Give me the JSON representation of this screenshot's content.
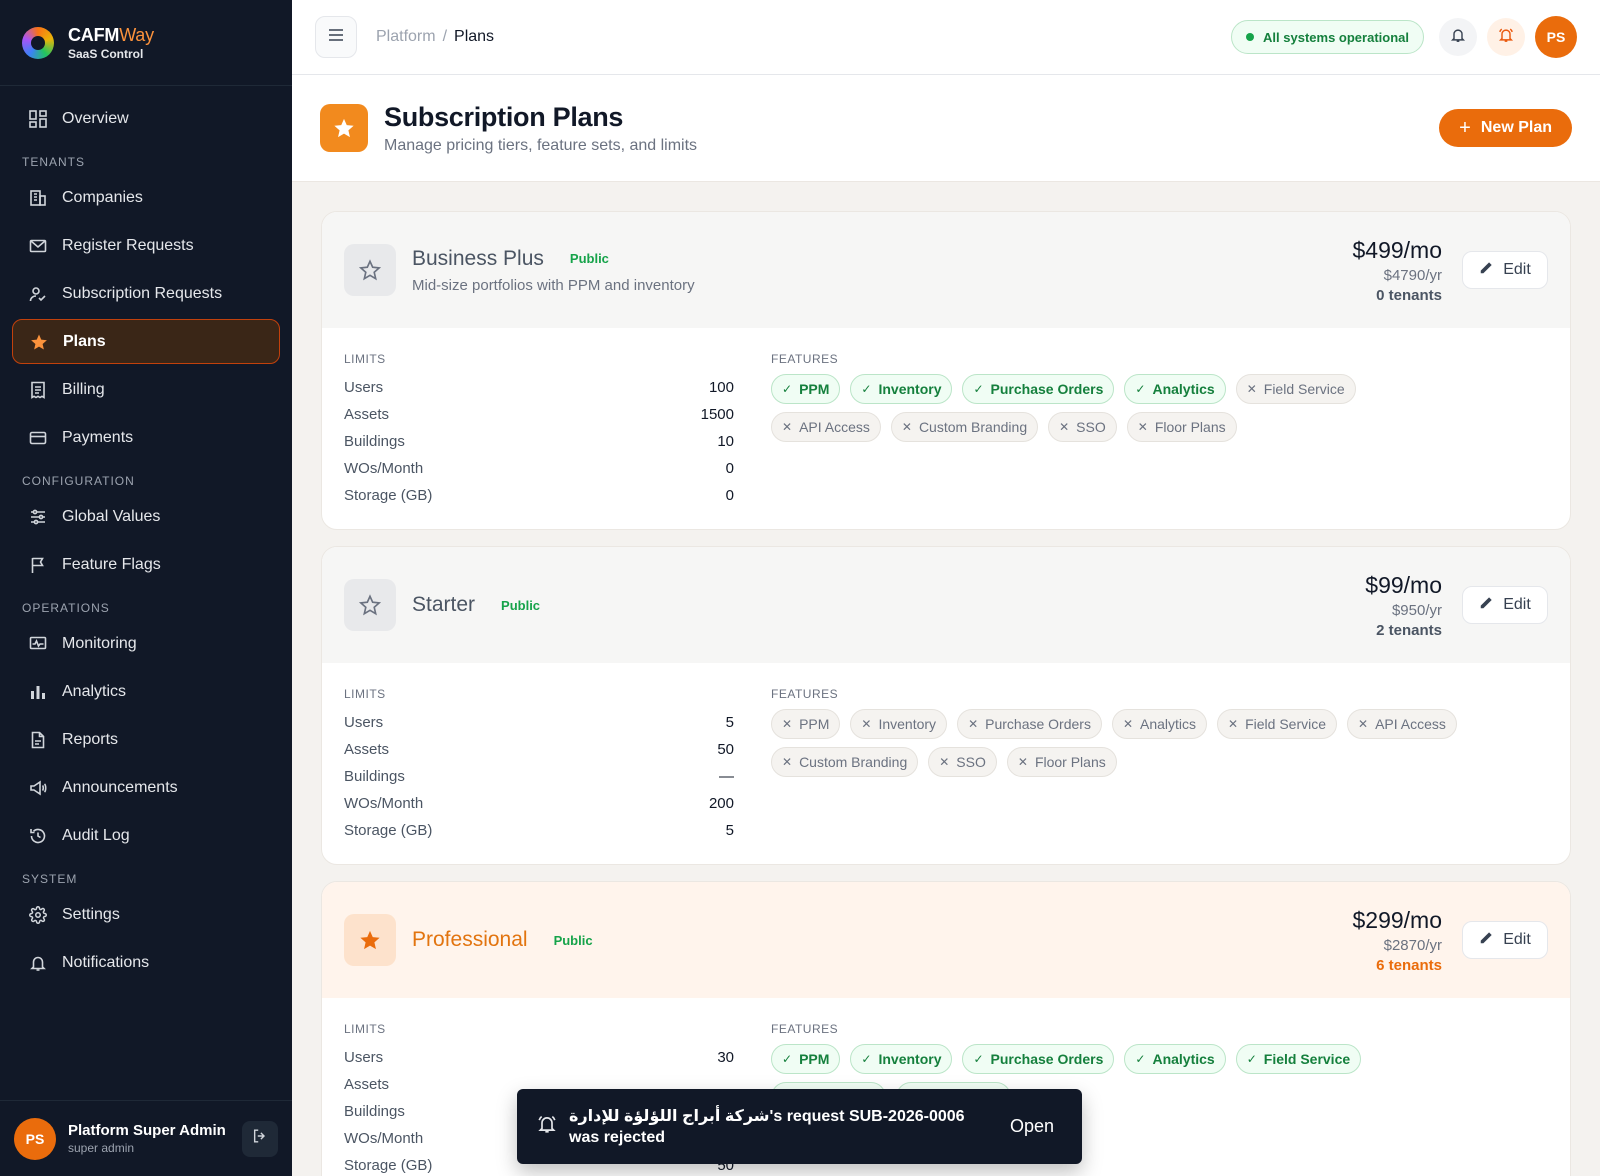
{
  "brand": {
    "name_main": "CAFM",
    "name_accent": "Way",
    "subtitle": "SaaS Control"
  },
  "sidebar": {
    "sections": {
      "tenants": "TENANTS",
      "configuration": "CONFIGURATION",
      "operations": "OPERATIONS",
      "system": "SYSTEM"
    },
    "items": {
      "overview": "Overview",
      "companies": "Companies",
      "register_requests": "Register Requests",
      "subscription_requests": "Subscription Requests",
      "plans": "Plans",
      "billing": "Billing",
      "payments": "Payments",
      "global_values": "Global Values",
      "feature_flags": "Feature Flags",
      "monitoring": "Monitoring",
      "analytics": "Analytics",
      "reports": "Reports",
      "announcements": "Announcements",
      "audit_log": "Audit Log",
      "settings": "Settings",
      "notifications": "Notifications"
    },
    "user": {
      "initials": "PS",
      "name": "Platform Super Admin",
      "role": "super admin"
    }
  },
  "topbar": {
    "breadcrumb": [
      "Platform",
      "Plans"
    ],
    "breadcrumb_sep": "/",
    "status": "All systems operational",
    "avatar_initials": "PS"
  },
  "page": {
    "title": "Subscription Plans",
    "subtitle": "Manage pricing tiers, feature sets, and limits",
    "new_button": "New Plan"
  },
  "labels": {
    "limits": "LIMITS",
    "features": "FEATURES",
    "edit": "Edit"
  },
  "colors": {
    "accent": "#ea6c0c",
    "sidebar_bg": "#111827",
    "success": "#16a34a"
  },
  "plans": [
    {
      "name": "Business Plus",
      "visibility": "Public",
      "description": "Mid-size portfolios with PPM and inventory",
      "price_month": "$499/mo",
      "price_year": "$4790/yr",
      "tenants": "0 tenants",
      "featured": false,
      "limits": [
        {
          "label": "Users",
          "value": "100"
        },
        {
          "label": "Assets",
          "value": "1500"
        },
        {
          "label": "Buildings",
          "value": "10"
        },
        {
          "label": "WOs/Month",
          "value": "0"
        },
        {
          "label": "Storage (GB)",
          "value": "0"
        }
      ],
      "features": [
        {
          "label": "PPM",
          "enabled": true
        },
        {
          "label": "Inventory",
          "enabled": true
        },
        {
          "label": "Purchase Orders",
          "enabled": true
        },
        {
          "label": "Analytics",
          "enabled": true
        },
        {
          "label": "Field Service",
          "enabled": false
        },
        {
          "label": "API Access",
          "enabled": false
        },
        {
          "label": "Custom Branding",
          "enabled": false
        },
        {
          "label": "SSO",
          "enabled": false
        },
        {
          "label": "Floor Plans",
          "enabled": false
        }
      ]
    },
    {
      "name": "Starter",
      "visibility": "Public",
      "description": "",
      "price_month": "$99/mo",
      "price_year": "$950/yr",
      "tenants": "2 tenants",
      "featured": false,
      "limits": [
        {
          "label": "Users",
          "value": "5"
        },
        {
          "label": "Assets",
          "value": "50"
        },
        {
          "label": "Buildings",
          "value": "—"
        },
        {
          "label": "WOs/Month",
          "value": "200"
        },
        {
          "label": "Storage (GB)",
          "value": "5"
        }
      ],
      "features": [
        {
          "label": "PPM",
          "enabled": false
        },
        {
          "label": "Inventory",
          "enabled": false
        },
        {
          "label": "Purchase Orders",
          "enabled": false
        },
        {
          "label": "Analytics",
          "enabled": false
        },
        {
          "label": "Field Service",
          "enabled": false
        },
        {
          "label": "API Access",
          "enabled": false
        },
        {
          "label": "Custom Branding",
          "enabled": false
        },
        {
          "label": "SSO",
          "enabled": false
        },
        {
          "label": "Floor Plans",
          "enabled": false
        }
      ]
    },
    {
      "name": "Professional",
      "visibility": "Public",
      "description": "",
      "price_month": "$299/mo",
      "price_year": "$2870/yr",
      "tenants": "6 tenants",
      "featured": true,
      "limits": [
        {
          "label": "Users",
          "value": "30"
        },
        {
          "label": "Assets",
          "value": ""
        },
        {
          "label": "Buildings",
          "value": ""
        },
        {
          "label": "WOs/Month",
          "value": ""
        },
        {
          "label": "Storage (GB)",
          "value": "50"
        }
      ],
      "features": [
        {
          "label": "PPM",
          "enabled": true
        },
        {
          "label": "Inventory",
          "enabled": true
        },
        {
          "label": "Purchase Orders",
          "enabled": true
        },
        {
          "label": "Analytics",
          "enabled": true
        },
        {
          "label": "Field Service",
          "enabled": true
        },
        {
          "label": "API Access",
          "enabled": true
        },
        {
          "label": "Floor Plans",
          "enabled": true
        }
      ]
    }
  ],
  "toast": {
    "message": "شركة أبراج اللؤلؤة للإدارة's request SUB-2026-0006 was rejected",
    "action": "Open"
  }
}
